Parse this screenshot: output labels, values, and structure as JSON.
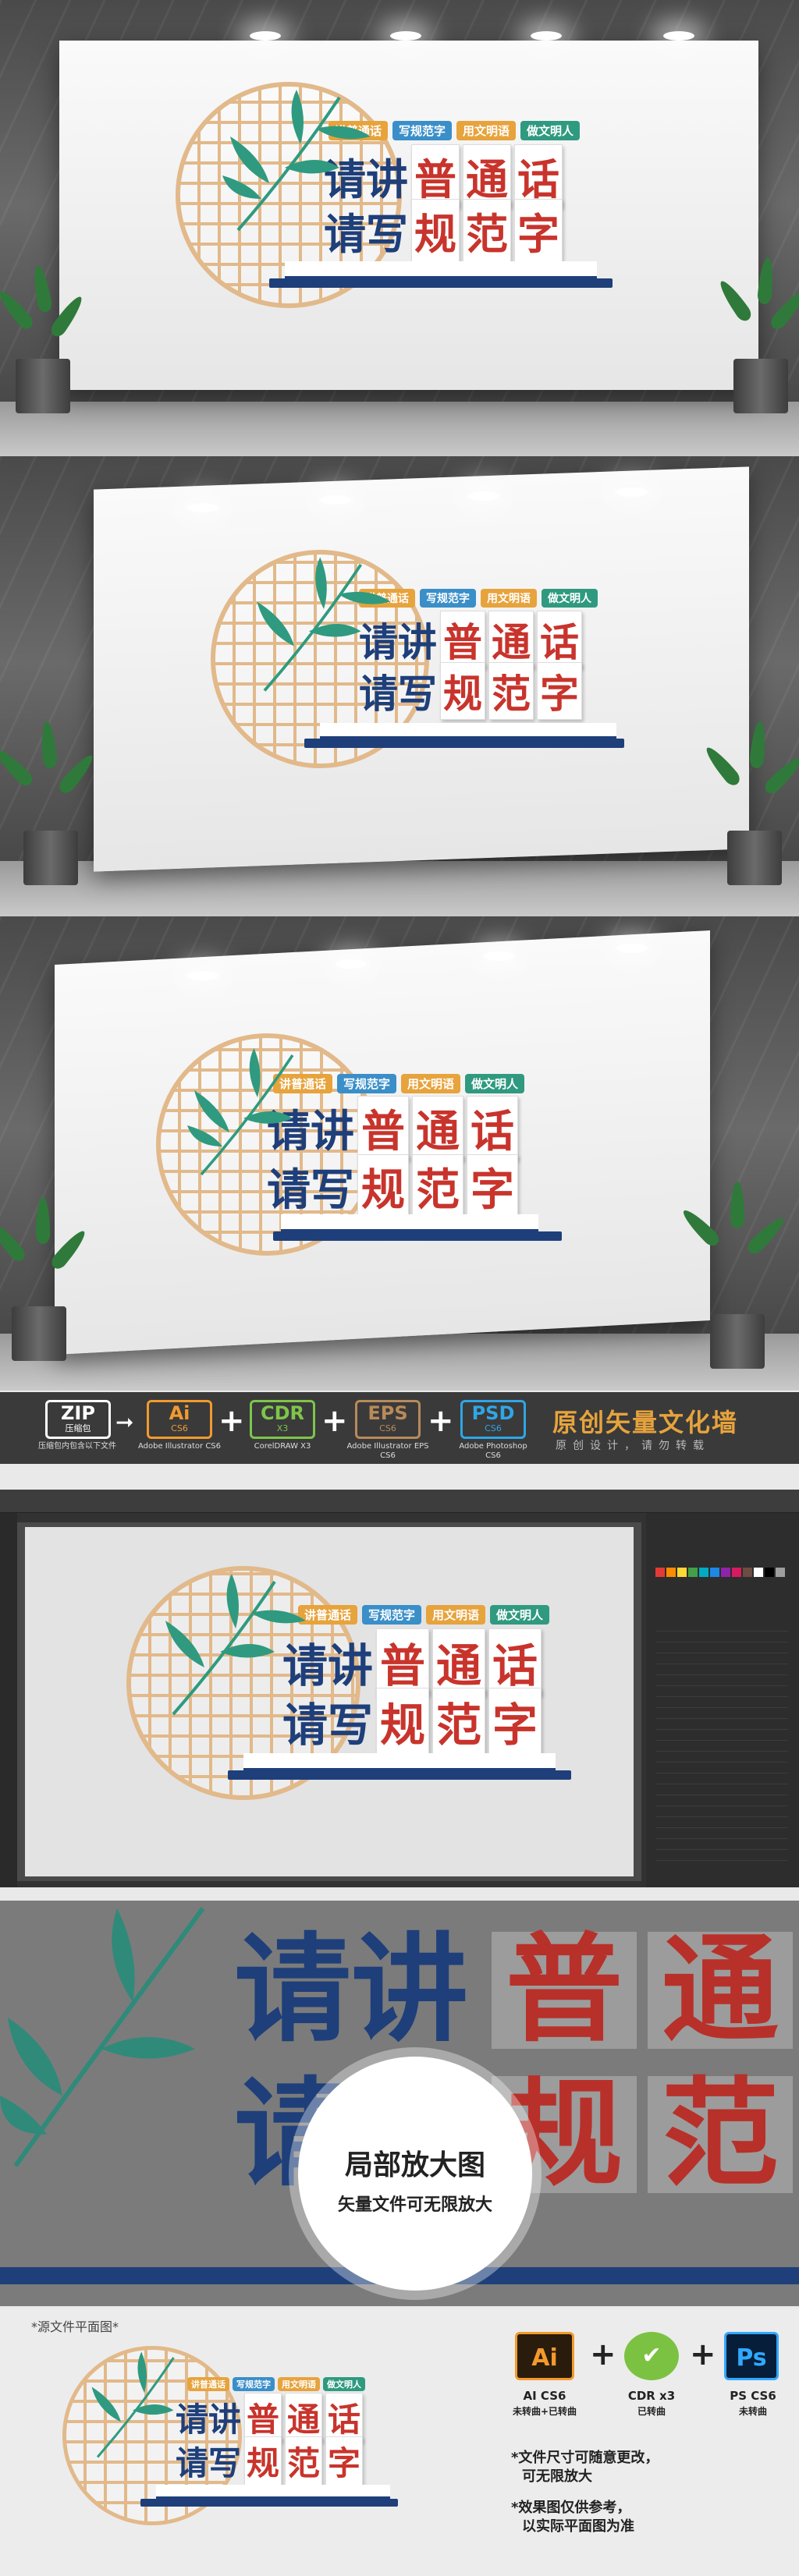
{
  "slogan": {
    "tags": [
      "讲普通话",
      "写规范字",
      "用文明语",
      "做文明人"
    ],
    "tag_colors": [
      "#e7a33c",
      "#3a8fc9",
      "#e7a33c",
      "#2f9a80"
    ],
    "line1_blue": "请讲",
    "line1_red": [
      "普",
      "通",
      "话"
    ],
    "line2_blue": "请写",
    "line2_red": [
      "规",
      "范",
      "字"
    ],
    "colors": {
      "blue": "#1e3f7a",
      "red": "#c8342c",
      "lattice": "#e2b98a",
      "bamboo": "#2f9a80"
    }
  },
  "formats": {
    "zip": {
      "badge": "ZIP",
      "sub": "压缩包",
      "label": "压缩包内包含以下文件"
    },
    "ai": {
      "badge": "Ai",
      "sub": "CS6",
      "label": "Adobe Illustrator CS6"
    },
    "cdr": {
      "badge": "CDR",
      "sub": "X3",
      "label": "CorelDRAW X3"
    },
    "eps": {
      "badge": "EPS",
      "sub": "CS6",
      "label": "Adobe Illustrator EPS CS6"
    },
    "psd": {
      "badge": "PSD",
      "sub": "CS6",
      "label": "Adobe Photoshop CS6"
    },
    "brand_title": "原创矢量文化墙",
    "brand_sub": "原创设计，请勿转载"
  },
  "zoom": {
    "title": "局部放大图",
    "subtitle": "矢量文件可无限放大",
    "big_blue_1": "请讲",
    "big_red_1": [
      "普",
      "通"
    ],
    "big_blue_2": "请写",
    "big_red_2": [
      "规",
      "范"
    ]
  },
  "bottom": {
    "source_label": "*源文件平面图*",
    "icons": [
      {
        "glyph": "Ai",
        "label": "AI CS6",
        "sub": "未转曲+已转曲"
      },
      {
        "glyph": "✔",
        "label": "CDR x3",
        "sub": "已转曲"
      },
      {
        "glyph": "Ps",
        "label": "PS CS6",
        "sub": "未转曲"
      }
    ],
    "note1": "*文件尺寸可随意更改，",
    "note1b": "可无限放大",
    "note2": "*效果图仅供参考，",
    "note2b": "以实际平面图为准"
  }
}
